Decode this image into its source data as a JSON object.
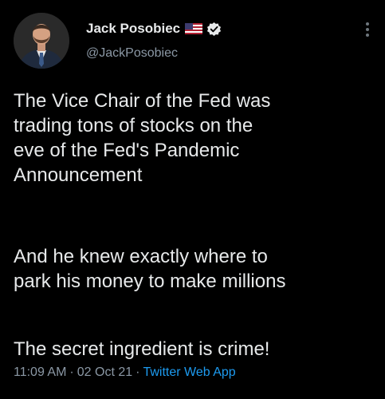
{
  "tweet": {
    "author": {
      "display_name": "Jack Posobiec",
      "handle": "@JackPosobiec",
      "flag_icon": "us-flag-icon",
      "verified_icon": "verified-badge-icon"
    },
    "menu_icon": "more-vertical-icon",
    "paragraphs": [
      "The Vice Chair of the Fed was\ntrading tons of stocks on the\neve of the Fed's Pandemic\nAnnouncement",
      "And he knew exactly where to\npark his money to make millions",
      "The secret ingredient is crime!"
    ],
    "time": "11:09 AM",
    "separator": "·",
    "date": "02 Oct 21",
    "source": "Twitter Web App"
  },
  "colors": {
    "background": "#000000",
    "text": "#e7e9ea",
    "muted": "#8b98a5",
    "link": "#1d9bf0"
  }
}
